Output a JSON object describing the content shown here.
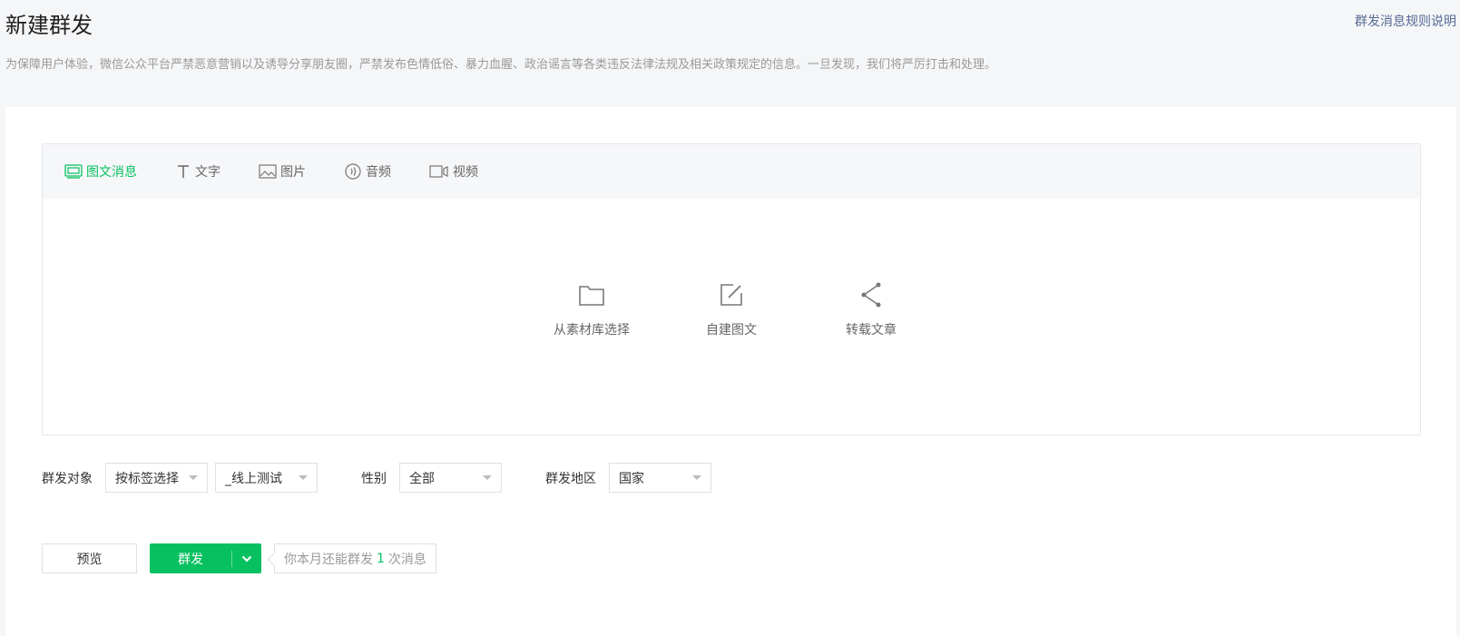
{
  "header": {
    "title": "新建群发",
    "rules_link": "群发消息规则说明",
    "notice": "为保障用户体验，微信公众平台严禁恶意营销以及诱导分享朋友圈，严禁发布色情低俗、暴力血腥、政治谣言等各类违反法律法规及相关政策规定的信息。一旦发现，我们将严厉打击和处理。"
  },
  "tabs": [
    {
      "label": "图文消息",
      "icon": "news-icon",
      "active": true
    },
    {
      "label": "文字",
      "icon": "text-icon",
      "active": false
    },
    {
      "label": "图片",
      "icon": "image-icon",
      "active": false
    },
    {
      "label": "音频",
      "icon": "audio-icon",
      "active": false
    },
    {
      "label": "视频",
      "icon": "video-icon",
      "active": false
    }
  ],
  "create_actions": [
    {
      "label": "从素材库选择",
      "icon": "folder-icon"
    },
    {
      "label": "自建图文",
      "icon": "edit-icon"
    },
    {
      "label": "转载文章",
      "icon": "share-icon"
    }
  ],
  "filters": {
    "target_label": "群发对象",
    "target_mode": "按标签选择",
    "target_tag": "_线上测试",
    "gender_label": "性别",
    "gender_value": "全部",
    "region_label": "群发地区",
    "region_value": "国家"
  },
  "buttons": {
    "preview": "预览",
    "send": "群发"
  },
  "quota": {
    "prefix": "你本月还能群发",
    "count": "1",
    "suffix": "次消息"
  },
  "colors": {
    "accent": "#07c160",
    "link": "#576b95",
    "background": "#f5f6f8"
  }
}
